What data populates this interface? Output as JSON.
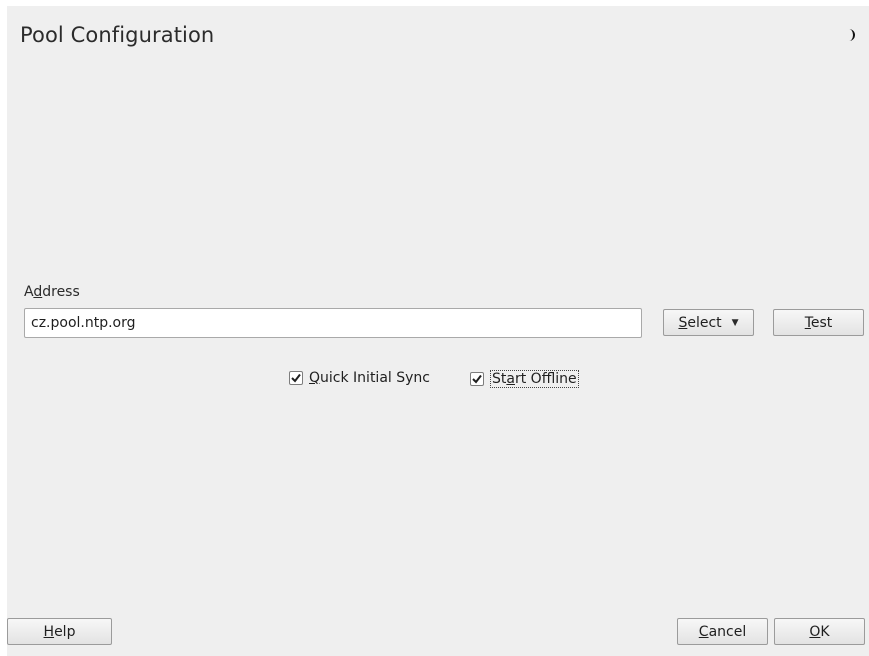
{
  "dialog": {
    "title": "Pool Configuration",
    "corner_icon": "half-moon-icon"
  },
  "address": {
    "label_before": "A",
    "label_mnemonic": "d",
    "label_after": "dress",
    "value": "cz.pool.ntp.org"
  },
  "buttons": {
    "select": {
      "mnemonic": "S",
      "rest": "elect",
      "icon": "triangle-down-icon"
    },
    "test": {
      "mnemonic": "T",
      "rest": "est"
    },
    "help": {
      "mnemonic": "H",
      "rest": "elp"
    },
    "cancel": {
      "mnemonic": "C",
      "rest": "ancel"
    },
    "ok": {
      "mnemonic": "O",
      "rest": "K"
    }
  },
  "options": {
    "quick_initial_sync": {
      "mnemonic": "Q",
      "rest": "uick Initial Sync",
      "checked": true
    },
    "start_offline": {
      "before": "St",
      "mnemonic": "a",
      "rest": "rt Offline",
      "checked": true,
      "focused": true
    }
  }
}
